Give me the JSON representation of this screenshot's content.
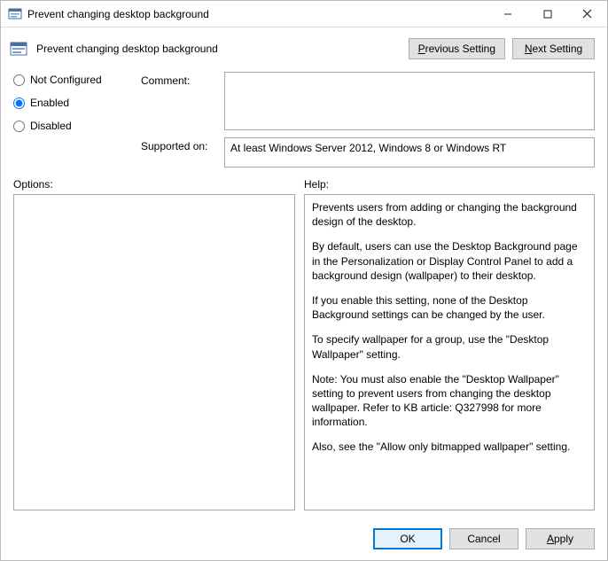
{
  "window": {
    "title": "Prevent changing desktop background"
  },
  "header": {
    "policy_name": "Prevent changing desktop background",
    "prev_label_pre": "P",
    "prev_label_post": "revious Setting",
    "next_label_pre": "N",
    "next_label_post": "ext Setting"
  },
  "state": {
    "not_configured_label": "Not Configured",
    "enabled_label": "Enabled",
    "disabled_label": "Disabled",
    "selected": "enabled"
  },
  "fields": {
    "comment_label": "Comment:",
    "comment_value": "",
    "supported_label": "Supported on:",
    "supported_value": "At least Windows Server 2012, Windows 8 or Windows RT"
  },
  "sections": {
    "options_label": "Options:",
    "help_label": "Help:"
  },
  "help": {
    "p1": "Prevents users from adding or changing the background design of the desktop.",
    "p2": "By default, users can use the Desktop Background page in the Personalization or Display Control Panel to add a background design (wallpaper) to their desktop.",
    "p3": "If you enable this setting, none of the Desktop Background settings can be changed by the user.",
    "p4": "To specify wallpaper for a group, use the \"Desktop Wallpaper\" setting.",
    "p5": "Note: You must also enable the \"Desktop Wallpaper\" setting to prevent users from changing the desktop wallpaper. Refer to KB article: Q327998 for more information.",
    "p6": "Also, see the \"Allow only bitmapped wallpaper\" setting."
  },
  "footer": {
    "ok_label": "OK",
    "cancel_label": "Cancel",
    "apply_label_pre": "A",
    "apply_label_post": "pply"
  }
}
